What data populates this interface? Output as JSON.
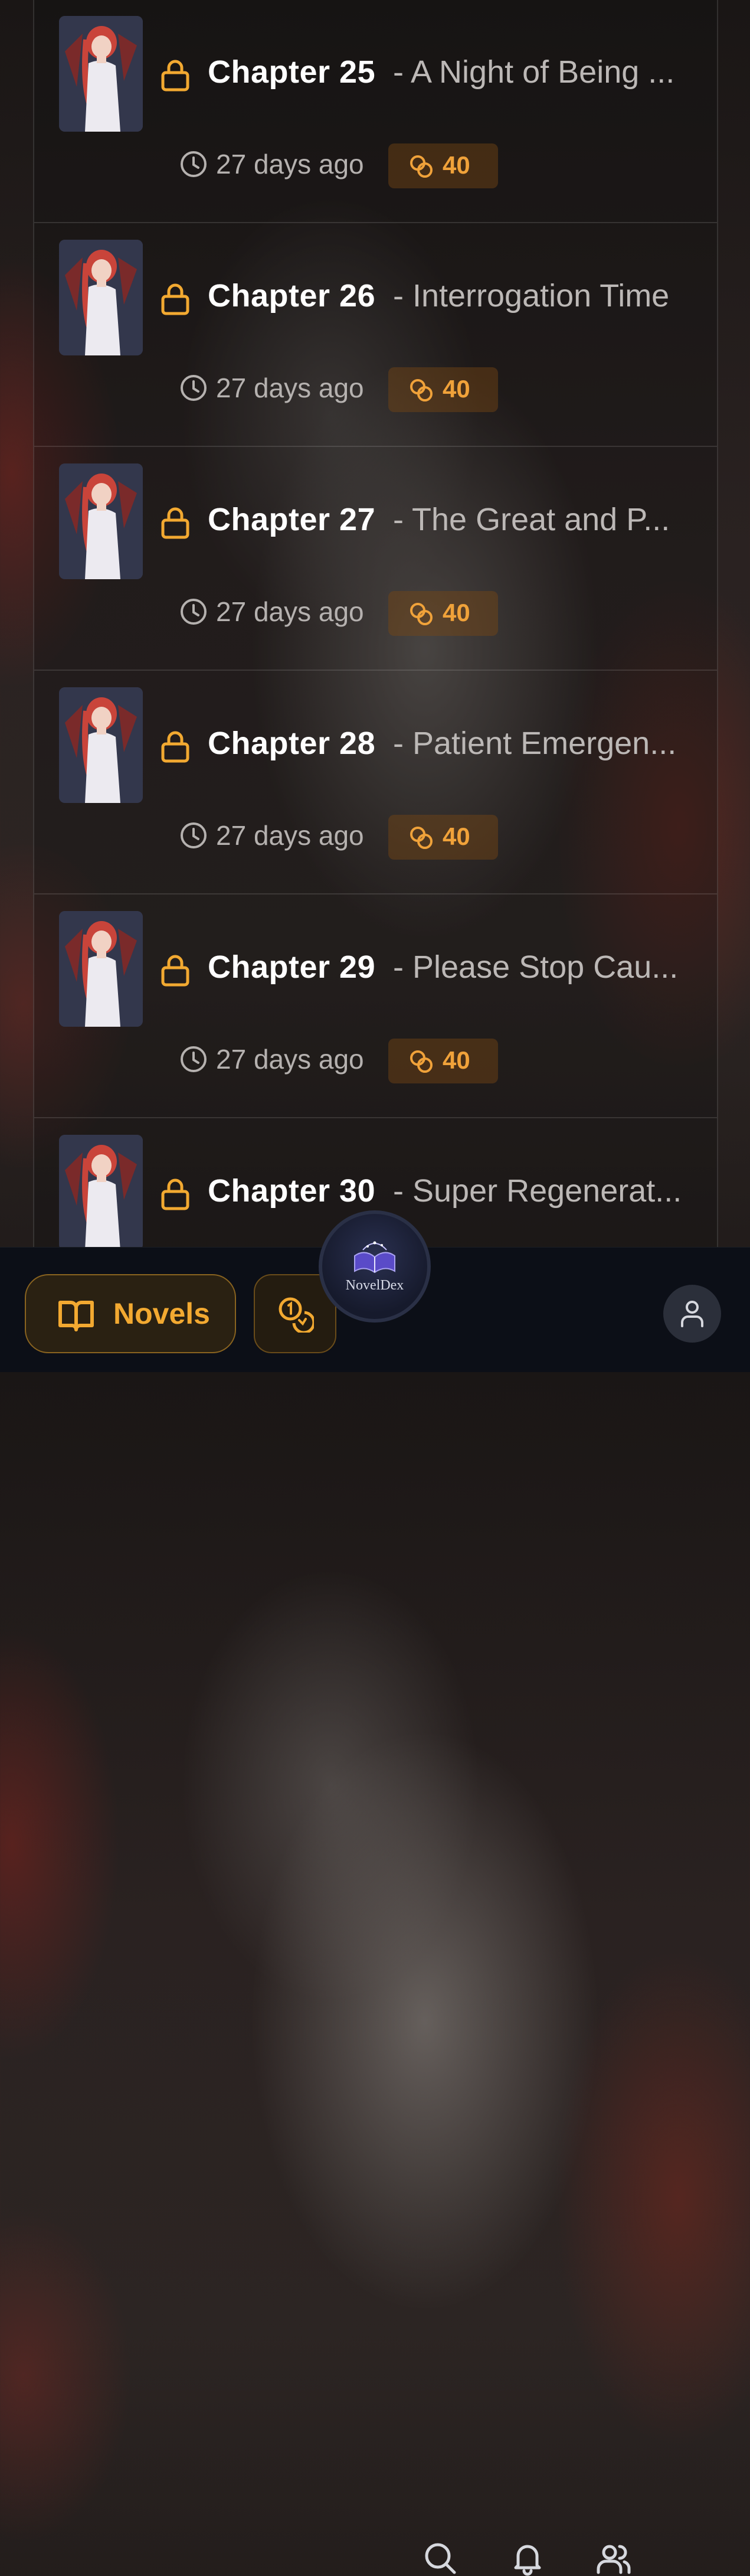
{
  "chapters": [
    {
      "number": "Chapter 25",
      "title": "- A Night of Being ...",
      "time": "27 days ago",
      "price": "40"
    },
    {
      "number": "Chapter 26",
      "title": "- Interrogation Time",
      "time": "27 days ago",
      "price": "40"
    },
    {
      "number": "Chapter 27",
      "title": "- The Great and P...",
      "time": "27 days ago",
      "price": "40"
    },
    {
      "number": "Chapter 28",
      "title": "- Patient Emergen...",
      "time": "27 days ago",
      "price": "40"
    },
    {
      "number": "Chapter 29",
      "title": "- Please Stop Cau...",
      "time": "27 days ago",
      "price": "40"
    },
    {
      "number": "Chapter 30",
      "title": "- Super Regenerat...",
      "time": "",
      "price": ""
    }
  ],
  "icons": {
    "lock": "lock-icon",
    "clock": "clock-icon",
    "coin": "coins-icon"
  },
  "nav": {
    "novels_label": "Novels",
    "brand": "NovelDex",
    "items": [
      "coins",
      "home-logo",
      "search",
      "notifications",
      "community",
      "profile"
    ]
  },
  "colors": {
    "accent": "#f2a931",
    "price_text": "#f0a23a",
    "nav_bg": "#0c0f17"
  }
}
